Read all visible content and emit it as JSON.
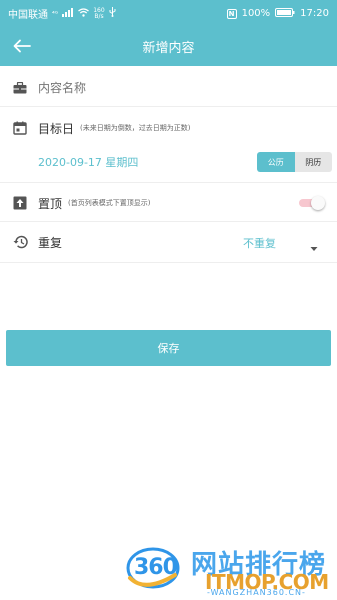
{
  "status_bar": {
    "carrier": "中国联通",
    "net_type": "⁴ᴳ",
    "speed_value": "160",
    "speed_unit": "B/s",
    "nfc": "N",
    "battery": "100%",
    "time": "17:20"
  },
  "app_bar": {
    "title": "新增内容"
  },
  "content_name": {
    "placeholder": "内容名称"
  },
  "target_date": {
    "label": "目标日",
    "hint": "(未来日期为倒数，过去日期为正数)",
    "value": "2020-09-17 星期四",
    "calendar_options": [
      "公历",
      "阴历"
    ],
    "selected_calendar": "公历"
  },
  "pin_top": {
    "label": "置顶",
    "hint": "(首页列表模式下置顶显示)",
    "enabled": false
  },
  "repeat": {
    "label": "重复",
    "value": "不重复"
  },
  "save_button": {
    "label": "保存"
  },
  "watermark": {
    "logo_text": "360",
    "cn_text": "网站排行榜",
    "domain": "ITMOP.COM",
    "sub": "-WANGZHAN360.CN-"
  },
  "colors": {
    "accent": "#5cbfcd",
    "toggle_off_track": "#f7c7cf"
  }
}
